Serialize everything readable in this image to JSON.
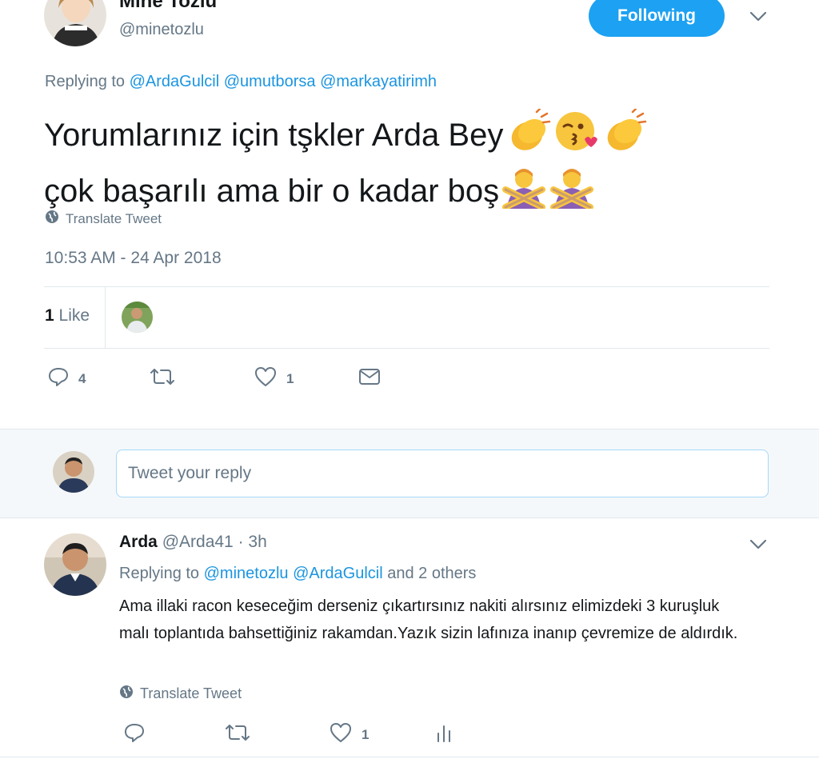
{
  "tweet": {
    "author_name": "Mine Tozlu",
    "author_handle": "@minetozlu",
    "follow_label": "Following",
    "replying_prefix": "Replying to",
    "replying_mentions": [
      "@ArdaGulcil",
      "@umutborsa",
      "@markayatirimh"
    ],
    "text_line1": "Yorumlarınız için tşkler Arda Bey",
    "text_line2": "çok başarılı ama bir o kadar boş",
    "translate_label": "Translate Tweet",
    "timestamp": "10:53 AM - 24 Apr 2018",
    "likes_count": "1",
    "likes_word": "Like",
    "actions": {
      "replies": "4",
      "retweets": "",
      "likes": "1"
    }
  },
  "composer": {
    "placeholder": "Tweet your reply"
  },
  "reply": {
    "author_name": "Arda",
    "author_handle": "@Arda41",
    "time": "· 3h",
    "replying_prefix": "Replying to",
    "replying_mentions": [
      "@minetozlu",
      "@ArdaGulcil"
    ],
    "replying_suffix": "and 2 others",
    "text": "Ama illaki racon keseceğim derseniz çıkartırsınız nakiti alırsınız elimizdeki 3 kuruşluk malı toplantıda bahsettiğiniz rakamdan.Yazık sizin lafınıza inanıp çevremize de aldırdık.",
    "translate_label": "Translate Tweet",
    "actions": {
      "replies": "",
      "retweets": "",
      "likes": "1"
    }
  },
  "colors": {
    "accent": "#1da1f2",
    "link": "#1b95e0",
    "muted": "#657786",
    "text": "#14171a",
    "divider": "#e1e8ed",
    "band": "#f5f8fa"
  },
  "icons": [
    "chevron-down-icon",
    "globe-icon",
    "reply-icon",
    "retweet-icon",
    "heart-icon",
    "mail-icon",
    "analytics-icon",
    "clapping-hands-emoji",
    "kissing-face-emoji",
    "no-gesture-emoji"
  ]
}
